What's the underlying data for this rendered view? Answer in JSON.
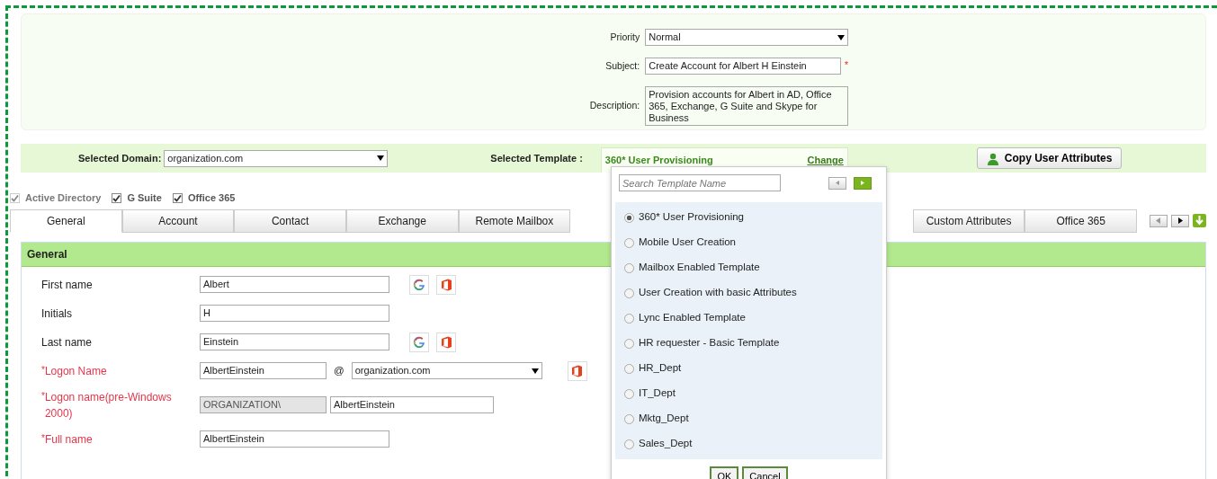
{
  "request": {
    "priority": {
      "label": "Priority",
      "value": "Normal"
    },
    "subject": {
      "label": "Subject:",
      "value": "Create Account for Albert H Einstein",
      "required_mark": "*"
    },
    "description": {
      "label": "Description:",
      "value": "Provision accounts for Albert in AD, Office 365, Exchange, G Suite and Skype for Business"
    }
  },
  "domain_bar": {
    "domain_label": "Selected Domain:",
    "domain": "organization.com",
    "template_label": "Selected Template :",
    "template": "360* User Provisioning",
    "change_link": "Change",
    "copy_button": "Copy User Attributes"
  },
  "targets": [
    {
      "label": "Active Directory",
      "checked": true,
      "disabled": true
    },
    {
      "label": "G Suite",
      "checked": true,
      "disabled": false
    },
    {
      "label": "Office 365",
      "checked": true,
      "disabled": false
    }
  ],
  "tabs": [
    {
      "label": "General",
      "selected": true
    },
    {
      "label": "Account",
      "selected": false
    },
    {
      "label": "Contact",
      "selected": false
    },
    {
      "label": "Exchange",
      "selected": false
    },
    {
      "label": "Remote Mailbox",
      "selected": false
    },
    {
      "label": "Custom Attributes",
      "selected": false
    },
    {
      "label": "Office 365",
      "selected": false
    }
  ],
  "section": {
    "title": "General",
    "rows": [
      {
        "label": "First name",
        "fields": [
          {
            "kind": "text",
            "value": "Albert"
          }
        ],
        "sync_icons": [
          {
            "kind": "google"
          },
          {
            "kind": "office"
          }
        ]
      },
      {
        "label": "Initials",
        "fields": [
          {
            "kind": "text",
            "value": "H"
          }
        ]
      },
      {
        "label": "Last name",
        "fields": [
          {
            "kind": "text",
            "value": "Einstein"
          }
        ],
        "sync_icons": [
          {
            "kind": "google"
          },
          {
            "kind": "office"
          }
        ]
      },
      {
        "label": "Logon Name",
        "required_mark": "*",
        "fields": [
          {
            "kind": "short",
            "value": "AlbertEinstein"
          },
          {
            "kind": "sep",
            "value": "@"
          },
          {
            "kind": "select",
            "value": "organization.com"
          }
        ],
        "sync_icons": [
          {
            "kind": "office"
          }
        ]
      },
      {
        "label": "Logon name(pre-Windows 2000)",
        "required_mark": "*",
        "fields": [
          {
            "kind": "readonly",
            "value": "ORGANIZATION\\"
          },
          {
            "kind": "mid",
            "value": "AlbertEinstein"
          }
        ]
      },
      {
        "label": "Full name",
        "required_mark": "*",
        "fields": [
          {
            "kind": "text",
            "value": "AlbertEinstein"
          }
        ]
      }
    ]
  },
  "template_popup": {
    "search": {
      "placeholder": "Search Template Name"
    },
    "templates": [
      {
        "label": "360* User Provisioning",
        "selected": true
      },
      {
        "label": "Mobile User Creation",
        "selected": false
      },
      {
        "label": "Mailbox Enabled Template",
        "selected": false
      },
      {
        "label": "User Creation with basic Attributes",
        "selected": false
      },
      {
        "label": "Lync Enabled Template",
        "selected": false
      },
      {
        "label": "HR requester - Basic Template",
        "selected": false
      },
      {
        "label": "HR_Dept",
        "selected": false
      },
      {
        "label": "IT_Dept",
        "selected": false
      },
      {
        "label": "Mktg_Dept",
        "selected": false
      },
      {
        "label": "Sales_Dept",
        "selected": false
      }
    ],
    "buttons": [
      "OK",
      "Cancel"
    ]
  }
}
